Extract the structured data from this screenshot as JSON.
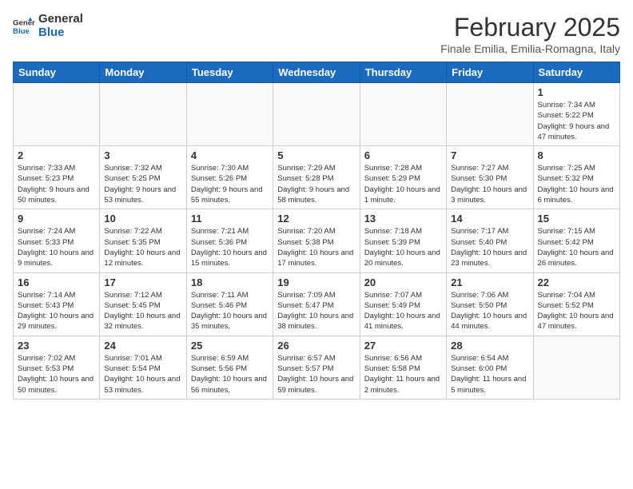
{
  "header": {
    "logo_line1": "General",
    "logo_line2": "Blue",
    "month_title": "February 2025",
    "location": "Finale Emilia, Emilia-Romagna, Italy"
  },
  "days_of_week": [
    "Sunday",
    "Monday",
    "Tuesday",
    "Wednesday",
    "Thursday",
    "Friday",
    "Saturday"
  ],
  "weeks": [
    [
      {
        "num": "",
        "info": ""
      },
      {
        "num": "",
        "info": ""
      },
      {
        "num": "",
        "info": ""
      },
      {
        "num": "",
        "info": ""
      },
      {
        "num": "",
        "info": ""
      },
      {
        "num": "",
        "info": ""
      },
      {
        "num": "1",
        "info": "Sunrise: 7:34 AM\nSunset: 5:22 PM\nDaylight: 9 hours and 47 minutes."
      }
    ],
    [
      {
        "num": "2",
        "info": "Sunrise: 7:33 AM\nSunset: 5:23 PM\nDaylight: 9 hours and 50 minutes."
      },
      {
        "num": "3",
        "info": "Sunrise: 7:32 AM\nSunset: 5:25 PM\nDaylight: 9 hours and 53 minutes."
      },
      {
        "num": "4",
        "info": "Sunrise: 7:30 AM\nSunset: 5:26 PM\nDaylight: 9 hours and 55 minutes."
      },
      {
        "num": "5",
        "info": "Sunrise: 7:29 AM\nSunset: 5:28 PM\nDaylight: 9 hours and 58 minutes."
      },
      {
        "num": "6",
        "info": "Sunrise: 7:28 AM\nSunset: 5:29 PM\nDaylight: 10 hours and 1 minute."
      },
      {
        "num": "7",
        "info": "Sunrise: 7:27 AM\nSunset: 5:30 PM\nDaylight: 10 hours and 3 minutes."
      },
      {
        "num": "8",
        "info": "Sunrise: 7:25 AM\nSunset: 5:32 PM\nDaylight: 10 hours and 6 minutes."
      }
    ],
    [
      {
        "num": "9",
        "info": "Sunrise: 7:24 AM\nSunset: 5:33 PM\nDaylight: 10 hours and 9 minutes."
      },
      {
        "num": "10",
        "info": "Sunrise: 7:22 AM\nSunset: 5:35 PM\nDaylight: 10 hours and 12 minutes."
      },
      {
        "num": "11",
        "info": "Sunrise: 7:21 AM\nSunset: 5:36 PM\nDaylight: 10 hours and 15 minutes."
      },
      {
        "num": "12",
        "info": "Sunrise: 7:20 AM\nSunset: 5:38 PM\nDaylight: 10 hours and 17 minutes."
      },
      {
        "num": "13",
        "info": "Sunrise: 7:18 AM\nSunset: 5:39 PM\nDaylight: 10 hours and 20 minutes."
      },
      {
        "num": "14",
        "info": "Sunrise: 7:17 AM\nSunset: 5:40 PM\nDaylight: 10 hours and 23 minutes."
      },
      {
        "num": "15",
        "info": "Sunrise: 7:15 AM\nSunset: 5:42 PM\nDaylight: 10 hours and 26 minutes."
      }
    ],
    [
      {
        "num": "16",
        "info": "Sunrise: 7:14 AM\nSunset: 5:43 PM\nDaylight: 10 hours and 29 minutes."
      },
      {
        "num": "17",
        "info": "Sunrise: 7:12 AM\nSunset: 5:45 PM\nDaylight: 10 hours and 32 minutes."
      },
      {
        "num": "18",
        "info": "Sunrise: 7:11 AM\nSunset: 5:46 PM\nDaylight: 10 hours and 35 minutes."
      },
      {
        "num": "19",
        "info": "Sunrise: 7:09 AM\nSunset: 5:47 PM\nDaylight: 10 hours and 38 minutes."
      },
      {
        "num": "20",
        "info": "Sunrise: 7:07 AM\nSunset: 5:49 PM\nDaylight: 10 hours and 41 minutes."
      },
      {
        "num": "21",
        "info": "Sunrise: 7:06 AM\nSunset: 5:50 PM\nDaylight: 10 hours and 44 minutes."
      },
      {
        "num": "22",
        "info": "Sunrise: 7:04 AM\nSunset: 5:52 PM\nDaylight: 10 hours and 47 minutes."
      }
    ],
    [
      {
        "num": "23",
        "info": "Sunrise: 7:02 AM\nSunset: 5:53 PM\nDaylight: 10 hours and 50 minutes."
      },
      {
        "num": "24",
        "info": "Sunrise: 7:01 AM\nSunset: 5:54 PM\nDaylight: 10 hours and 53 minutes."
      },
      {
        "num": "25",
        "info": "Sunrise: 6:59 AM\nSunset: 5:56 PM\nDaylight: 10 hours and 56 minutes."
      },
      {
        "num": "26",
        "info": "Sunrise: 6:57 AM\nSunset: 5:57 PM\nDaylight: 10 hours and 59 minutes."
      },
      {
        "num": "27",
        "info": "Sunrise: 6:56 AM\nSunset: 5:58 PM\nDaylight: 11 hours and 2 minutes."
      },
      {
        "num": "28",
        "info": "Sunrise: 6:54 AM\nSunset: 6:00 PM\nDaylight: 11 hours and 5 minutes."
      },
      {
        "num": "",
        "info": ""
      }
    ]
  ]
}
